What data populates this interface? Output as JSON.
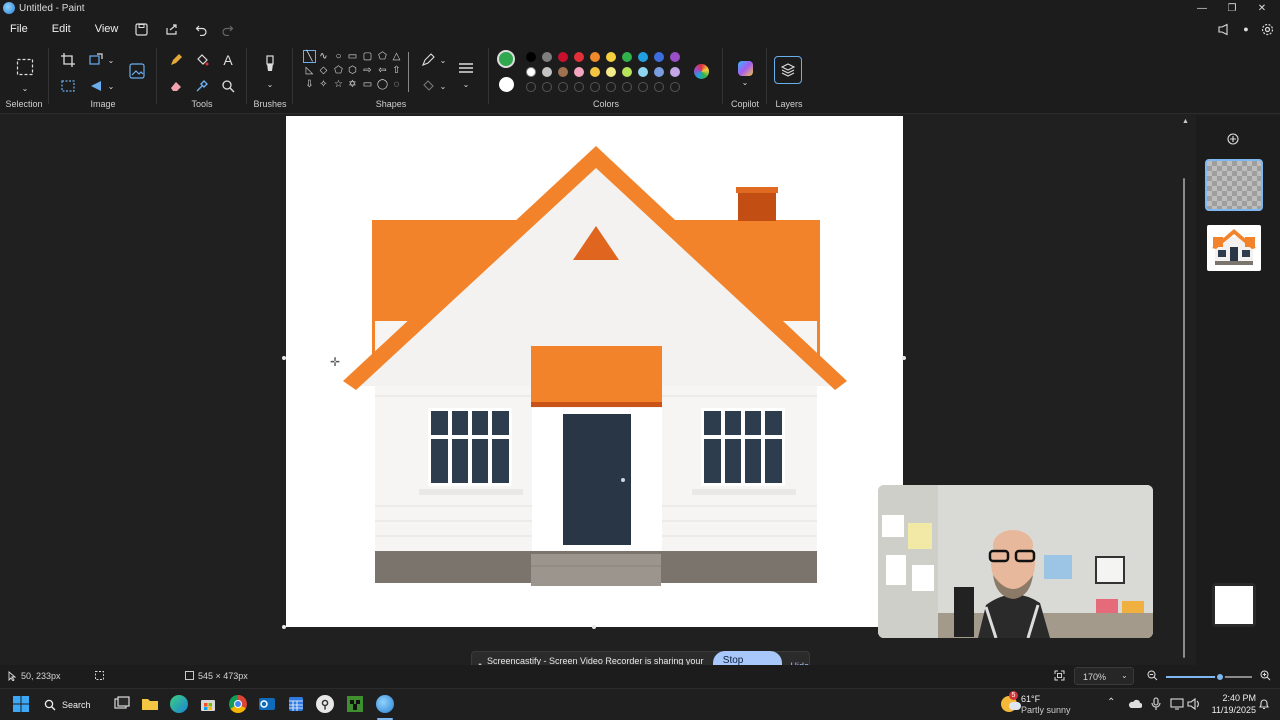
{
  "window": {
    "title": "Untitled - Paint",
    "minimize": "—",
    "maximize": "❐",
    "close": "✕"
  },
  "menu": {
    "file": "File",
    "edit": "Edit",
    "view": "View"
  },
  "ribbon": {
    "groups": {
      "selection": "Selection",
      "image": "Image",
      "tools": "Tools",
      "brushes": "Brushes",
      "shapes": "Shapes",
      "colors": "Colors",
      "copilot": "Copilot",
      "layers": "Layers"
    },
    "primary_color": "#2fa84f",
    "secondary_color": "#ffffff",
    "palette_row1": [
      "#000000",
      "#7f7f7f",
      "#c8102e",
      "#e0303a",
      "#f08a2b",
      "#f4d03f",
      "#2fb34a",
      "#20a0e0",
      "#3c6ee0",
      "#9a4fc8"
    ],
    "palette_row2": [
      "#ffffff",
      "#c3c3c3",
      "#a0714f",
      "#f4a6c0",
      "#f5c342",
      "#f3ec8a",
      "#b5e35a",
      "#8fd6f0",
      "#7a9de0",
      "#c3a6e6"
    ]
  },
  "status": {
    "cursor_position": "50, 233px",
    "image_size": "545 × 473px",
    "zoom": "170%"
  },
  "share_bar": {
    "pause_icon": "⏸",
    "message": "Screencastify - Screen Video Recorder is sharing your screen.",
    "stop_label": "Stop sharing",
    "hide_label": "Hide"
  },
  "taskbar": {
    "search_label": "Search",
    "weather_temp": "61°F",
    "weather_desc": "Partly sunny",
    "weather_badge": "5",
    "time": "2:40 PM",
    "date": "11/19/2025"
  }
}
